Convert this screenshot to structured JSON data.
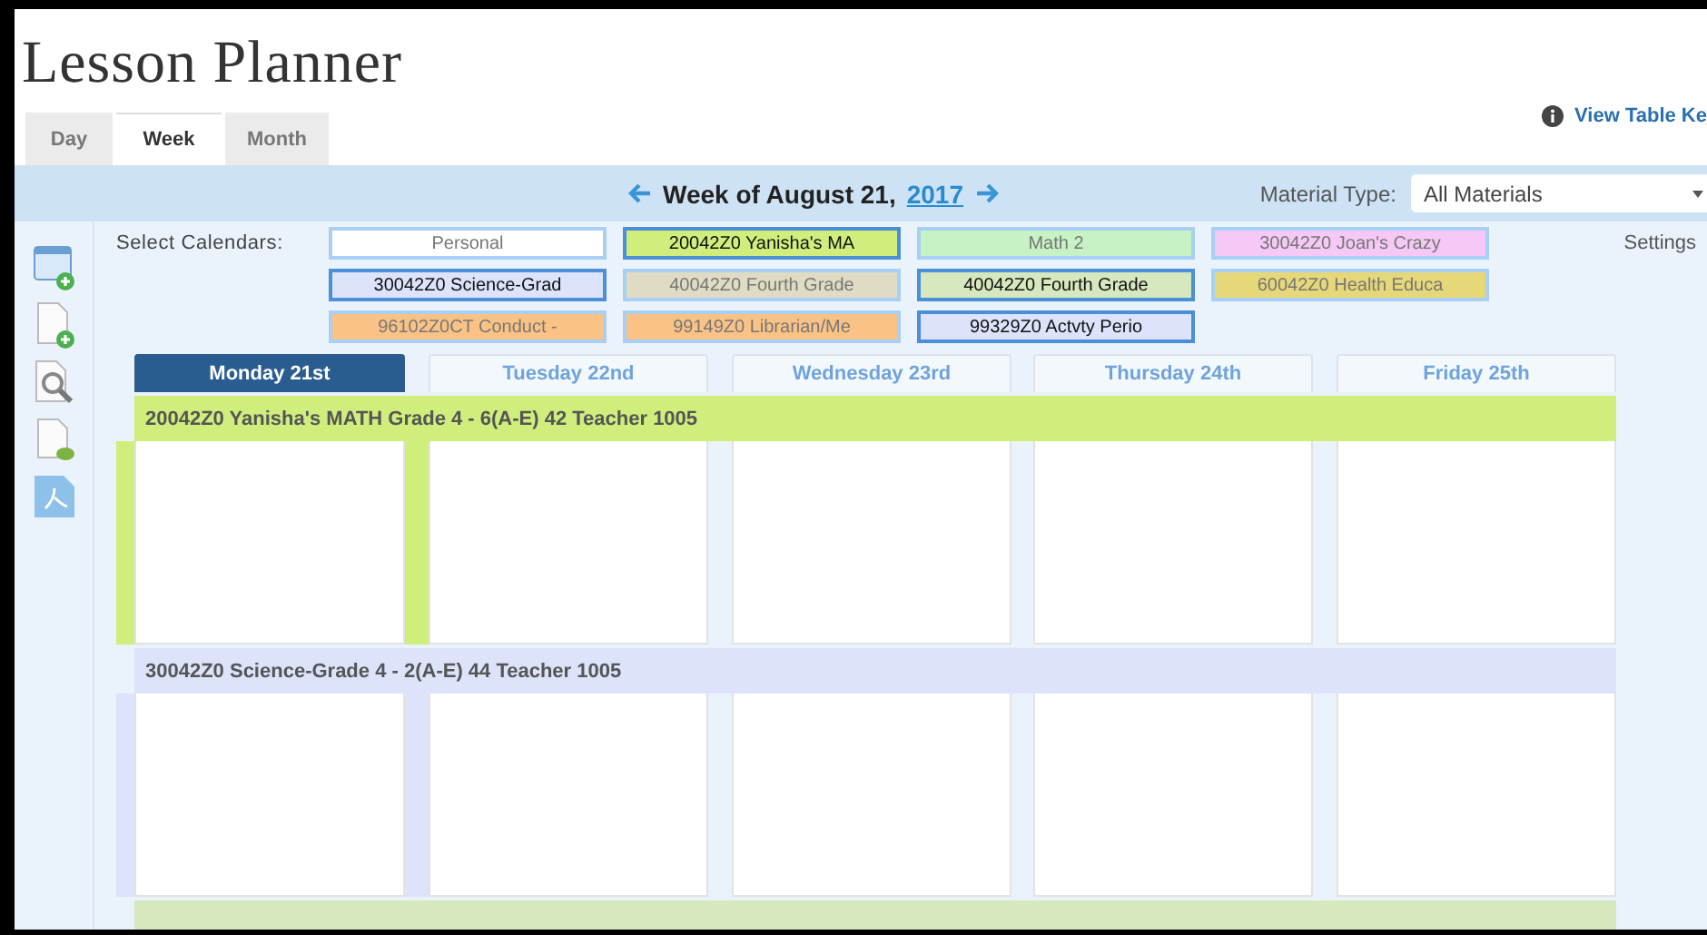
{
  "title": "Lesson Planner",
  "tabs": [
    {
      "label": "Day",
      "selected": false
    },
    {
      "label": "Week",
      "selected": true
    },
    {
      "label": "Month",
      "selected": false
    }
  ],
  "table_key_link": "View Table Ke",
  "week_nav": {
    "label": "Week of August 21, ",
    "year": "2017"
  },
  "material_type": {
    "label": "Material Type:",
    "value": "All Materials"
  },
  "calendars_label": "Select Calendars:",
  "calendars": [
    {
      "label": "Personal",
      "color": "#ffffff",
      "selected": false
    },
    {
      "label": "20042Z0 Yanisha's MA",
      "color": "#cfee7c",
      "selected": true
    },
    {
      "label": "Math 2",
      "color": "#c6f2c6",
      "selected": false
    },
    {
      "label": "30042Z0 Joan's Crazy",
      "color": "#f5c8f5",
      "selected": false
    },
    {
      "label": "30042Z0 Science-Grad",
      "color": "#dce3fb",
      "selected": true
    },
    {
      "label": "40042Z0 Fourth Grade",
      "color": "#e0dcc4",
      "selected": false
    },
    {
      "label": "40042Z0 Fourth Grade",
      "color": "#d6e8bd",
      "selected": true
    },
    {
      "label": "60042Z0 Health Educa",
      "color": "#e6d878",
      "selected": false
    },
    {
      "label": "96102Z0CT Conduct -",
      "color": "#fbc285",
      "selected": false
    },
    {
      "label": "99149Z0 Librarian/Me",
      "color": "#fbc285",
      "selected": false
    },
    {
      "label": "99329Z0 Actvty Perio",
      "color": "#dce3fb",
      "selected": true
    }
  ],
  "settings_link": "Settings",
  "days": [
    {
      "label": "Monday 21st",
      "selected": true
    },
    {
      "label": "Tuesday 22nd",
      "selected": false
    },
    {
      "label": "Wednesday 23rd",
      "selected": false
    },
    {
      "label": "Thursday 24th",
      "selected": false
    },
    {
      "label": "Friday 25th",
      "selected": false
    }
  ],
  "rows": [
    {
      "title": "20042Z0 Yanisha's MATH Grade 4 - 6(A-E) 42 Teacher 1005",
      "color": "#cfee7c",
      "cells": [
        {
          "marked": true
        },
        {
          "marked": true
        },
        {
          "marked": false
        },
        {
          "marked": false
        },
        {
          "marked": false
        }
      ]
    },
    {
      "title": "30042Z0 Science-Grade 4 - 2(A-E) 44 Teacher 1005",
      "color": "#dce3fb",
      "cells": [
        {
          "marked": true
        },
        {
          "marked": true
        },
        {
          "marked": false
        },
        {
          "marked": false
        },
        {
          "marked": false
        }
      ]
    },
    {
      "color": "#d6e8bd"
    }
  ]
}
